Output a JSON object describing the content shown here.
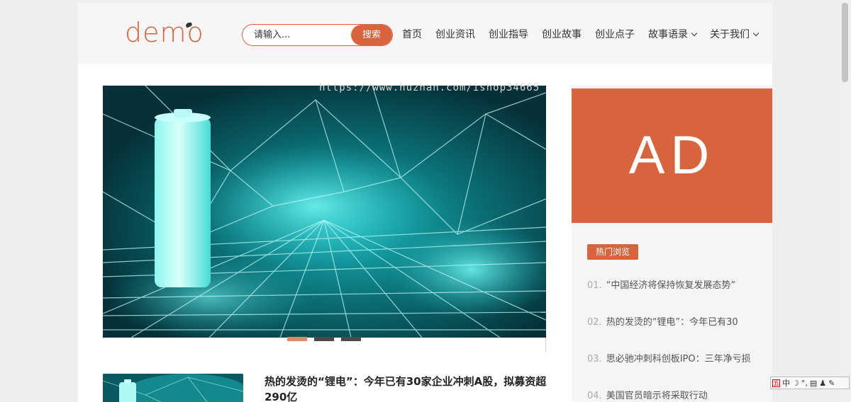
{
  "header": {
    "logo_text": "demo",
    "search": {
      "placeholder": "请输入...",
      "button_label": "搜索"
    },
    "nav": [
      {
        "label": "首页",
        "has_dropdown": false
      },
      {
        "label": "创业资讯",
        "has_dropdown": false
      },
      {
        "label": "创业指导",
        "has_dropdown": false
      },
      {
        "label": "创业故事",
        "has_dropdown": false
      },
      {
        "label": "创业点子",
        "has_dropdown": false
      },
      {
        "label": "故事语录",
        "has_dropdown": true
      },
      {
        "label": "关于我们",
        "has_dropdown": true
      }
    ]
  },
  "slider": {
    "watermark": "https://www.huzhan.com/ishop34665",
    "slide_count": 3,
    "active_slide": 1
  },
  "article": {
    "title": "热的发烫的“锂电”：今年已有30家企业冲刺A股，拟募资超290亿"
  },
  "sidebar": {
    "ad_text": "AD",
    "hot_label": "热门浏览",
    "hot_items": [
      {
        "num": "01.",
        "title": "“中国经济将保持恢复发展态势”"
      },
      {
        "num": "02.",
        "title": "热的发烫的“锂电”：今年已有30"
      },
      {
        "num": "03.",
        "title": "思必驰冲刺科创板IPO：三年净亏损"
      },
      {
        "num": "04.",
        "title": "美国官员暗示将采取行动"
      }
    ]
  },
  "ime": {
    "label": "中"
  },
  "colors": {
    "accent": "#d8643e",
    "header_bg": "#f6f6f6",
    "page_bg": "#eeeeee"
  }
}
